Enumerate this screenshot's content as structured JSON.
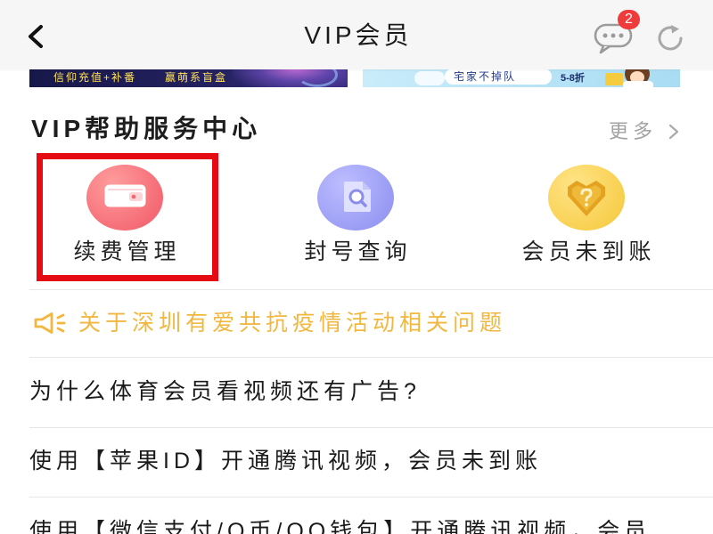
{
  "header": {
    "title": "VIP会员",
    "back_icon": "chevron-left-icon",
    "message_icon": "message-bubble-icon",
    "message_badge": "2",
    "refresh_icon": "refresh-icon"
  },
  "banners": [
    {
      "texts": [
        "信仰充值+补番",
        "赢萌系盲盒"
      ]
    },
    {
      "texts": [
        "宅家不掉队",
        "5-8折"
      ]
    }
  ],
  "help_center": {
    "title": "VIP帮助服务中心",
    "more_label": "更多",
    "more_icon": "chevron-right-icon",
    "services": [
      {
        "label": "续费管理",
        "icon": "wallet-icon",
        "color": "#f56c76",
        "highlighted": true
      },
      {
        "label": "封号查询",
        "icon": "search-document-icon",
        "color": "#9a9cf4",
        "highlighted": false
      },
      {
        "label": "会员未到账",
        "icon": "question-shield-icon",
        "color": "#f8d050",
        "highlighted": false
      }
    ]
  },
  "announcement": {
    "icon": "speaker-icon",
    "text": "关于深圳有爱共抗疫情活动相关问题"
  },
  "faq": [
    {
      "text": "为什么体育会员看视频还有广告?"
    },
    {
      "text": "使用【苹果ID】开通腾讯视频，会员未到账"
    },
    {
      "text": "使用【微信支付/Q币/QQ钱包】开通腾讯视频，会员"
    }
  ],
  "colors": {
    "highlight_border": "#e60b12",
    "badge": "#f03b3b",
    "announcement_text": "#f2b73f",
    "more_text": "#a3a3a3"
  }
}
